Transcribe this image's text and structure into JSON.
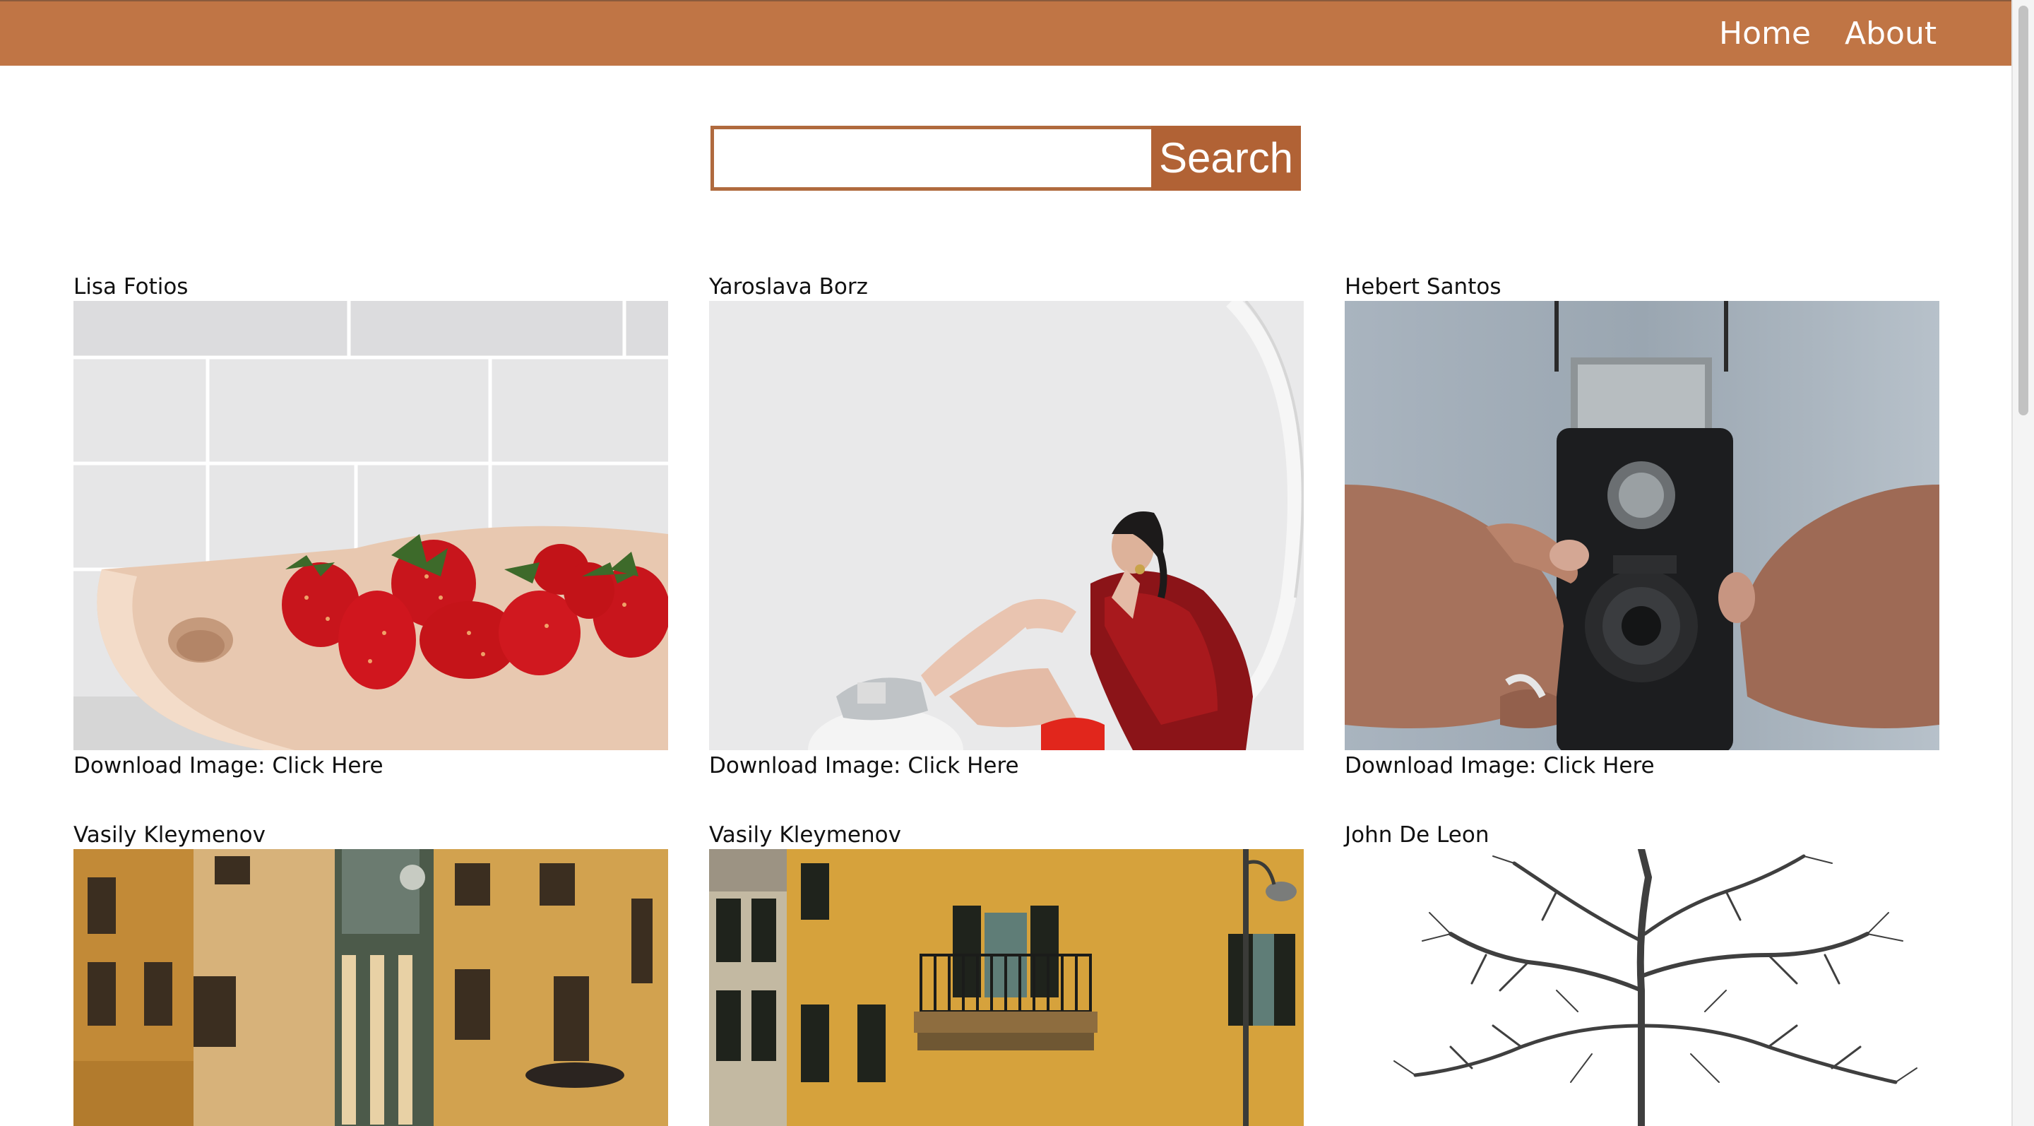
{
  "nav": {
    "home_label": "Home",
    "about_label": "About"
  },
  "search": {
    "value": "",
    "placeholder": "",
    "button_label": "Search"
  },
  "gallery": {
    "download_label": "Download Image:",
    "download_link_text": "Click Here",
    "items": [
      {
        "author": "Lisa Fotios",
        "photo_icon": "strawberries-photo"
      },
      {
        "author": "Yaroslava Borz",
        "photo_icon": "woman-seated-photo"
      },
      {
        "author": "Hebert Santos",
        "photo_icon": "vintage-camera-photo"
      },
      {
        "author": "Vasily Kleymenov",
        "photo_icon": "old-town-buildings-photo"
      },
      {
        "author": "Vasily Kleymenov",
        "photo_icon": "yellow-building-balcony-photo"
      },
      {
        "author": "John De Leon",
        "photo_icon": "bare-tree-photo"
      }
    ]
  },
  "colors": {
    "nav_background": "#c07545",
    "search_border": "#b06a3e",
    "search_button": "#b16235"
  }
}
